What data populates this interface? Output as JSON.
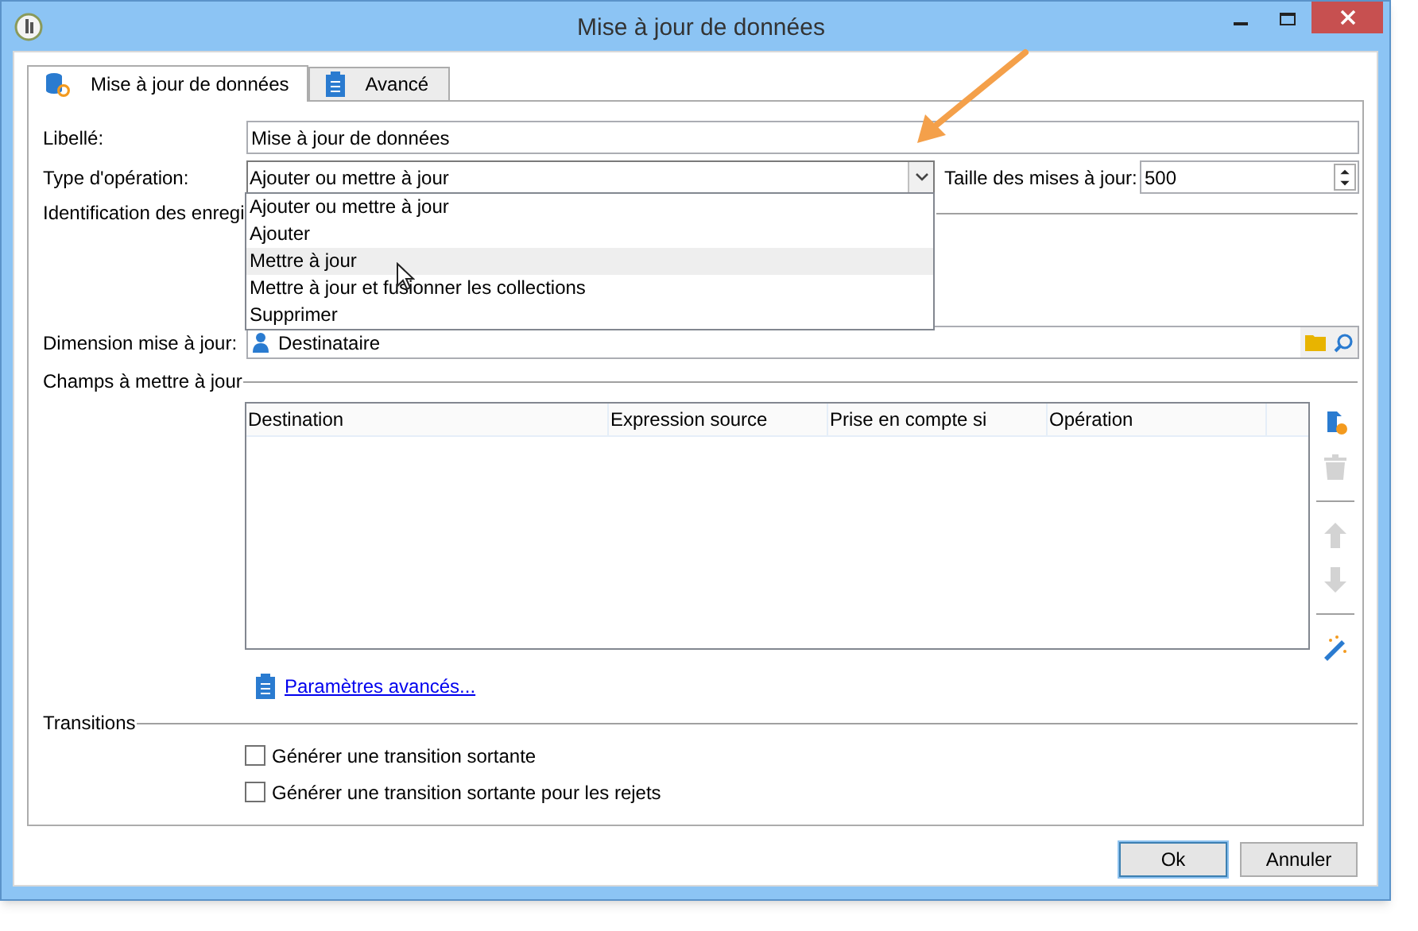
{
  "window": {
    "title": "Mise à jour de données"
  },
  "tabs": [
    {
      "label": "Mise à jour de données",
      "kind": "data",
      "selected": true
    },
    {
      "label": "Avancé",
      "kind": "clipboard",
      "selected": false
    }
  ],
  "form": {
    "name_field": {
      "label": "Libellé:",
      "value": "Mise à jour de données"
    },
    "operation": {
      "label": "Type d'opération:",
      "value": "Ajouter ou mettre à jour",
      "expanded": true,
      "options": [
        {
          "label": "Ajouter ou mettre à jour",
          "highlighted": false
        },
        {
          "label": "Ajouter",
          "highlighted": false
        },
        {
          "label": "Mettre à jour",
          "highlighted": true
        },
        {
          "label": "Mettre à jour et fusionner les collections",
          "highlighted": false
        },
        {
          "label": "Supprimer",
          "highlighted": false
        }
      ]
    },
    "batch_size": {
      "label": "Taille des mises à jour:",
      "value": "500"
    },
    "identification": {
      "label": "Identification des enregi"
    },
    "dimension": {
      "label": "Dimension mise à jour:",
      "value": "Destinataire"
    }
  },
  "fields_section": {
    "title": "Champs à mettre à jour",
    "columns": [
      "Destination",
      "Expression source",
      "Prise en compte si",
      "Opération"
    ],
    "toolbar": [
      {
        "kind": "add",
        "disabled": false
      },
      {
        "kind": "delete",
        "disabled": true
      },
      {
        "kind": "separator"
      },
      {
        "kind": "up",
        "disabled": true
      },
      {
        "kind": "down",
        "disabled": true
      },
      {
        "kind": "separator"
      },
      {
        "kind": "wand",
        "disabled": false
      }
    ],
    "advanced_link": "Paramètres avancés..."
  },
  "transitions": {
    "title": "Transitions",
    "options": [
      {
        "label": "Générer une transition sortante",
        "checked": false
      },
      {
        "label": "Générer une transition sortante pour les rejets",
        "checked": false
      }
    ]
  },
  "buttons": [
    {
      "label": "Ok",
      "default": true
    },
    {
      "label": "Annuler",
      "default": false
    }
  ]
}
